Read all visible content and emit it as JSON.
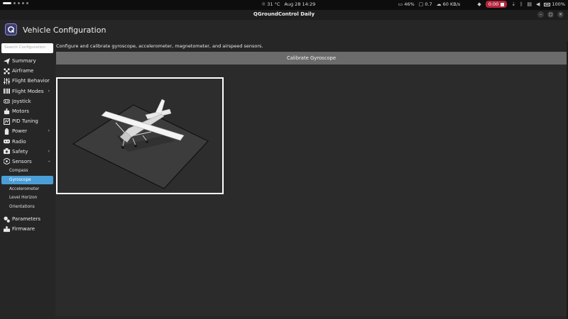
{
  "topbar": {
    "weather": "31 °C",
    "datetime": "Aug 28  14:29",
    "cpu": "46%",
    "load": "0.7",
    "net": "60 KB/s",
    "recording": "0:00",
    "battery": "100%"
  },
  "window": {
    "title": "QGroundControl Daily"
  },
  "app": {
    "title": "Vehicle Configuration"
  },
  "sidebar": {
    "search_placeholder": "Search Configuration",
    "items": [
      {
        "label": "Summary",
        "icon": "paper-plane-icon"
      },
      {
        "label": "Airframe",
        "icon": "airframe-icon"
      },
      {
        "label": "Flight Behavior",
        "icon": "sliders-icon"
      },
      {
        "label": "Flight Modes",
        "icon": "flight-modes-icon"
      },
      {
        "label": "Joystick",
        "icon": "joystick-icon"
      },
      {
        "label": "Motors",
        "icon": "motors-icon"
      },
      {
        "label": "PID Tuning",
        "icon": "pid-icon"
      },
      {
        "label": "Power",
        "icon": "power-icon"
      },
      {
        "label": "Radio",
        "icon": "radio-icon"
      },
      {
        "label": "Safety",
        "icon": "safety-icon"
      },
      {
        "label": "Sensors",
        "icon": "sensors-icon"
      }
    ],
    "sensor_subitems": [
      "Compass",
      "Gyroscope",
      "Accelerometer",
      "Level Horizon",
      "Orientations"
    ],
    "bottom_items": [
      {
        "label": "Parameters",
        "icon": "parameters-icon"
      },
      {
        "label": "Firmware",
        "icon": "firmware-icon"
      }
    ]
  },
  "main": {
    "description": "Configure and calibrate gyroscope, accelerometer, magnetometer, and airspeed sensors.",
    "calibrate_button": "Calibrate Gyroscope"
  },
  "colors": {
    "selected": "#4a9ed8",
    "button": "#6b6b6b",
    "record": "#b5243b"
  }
}
